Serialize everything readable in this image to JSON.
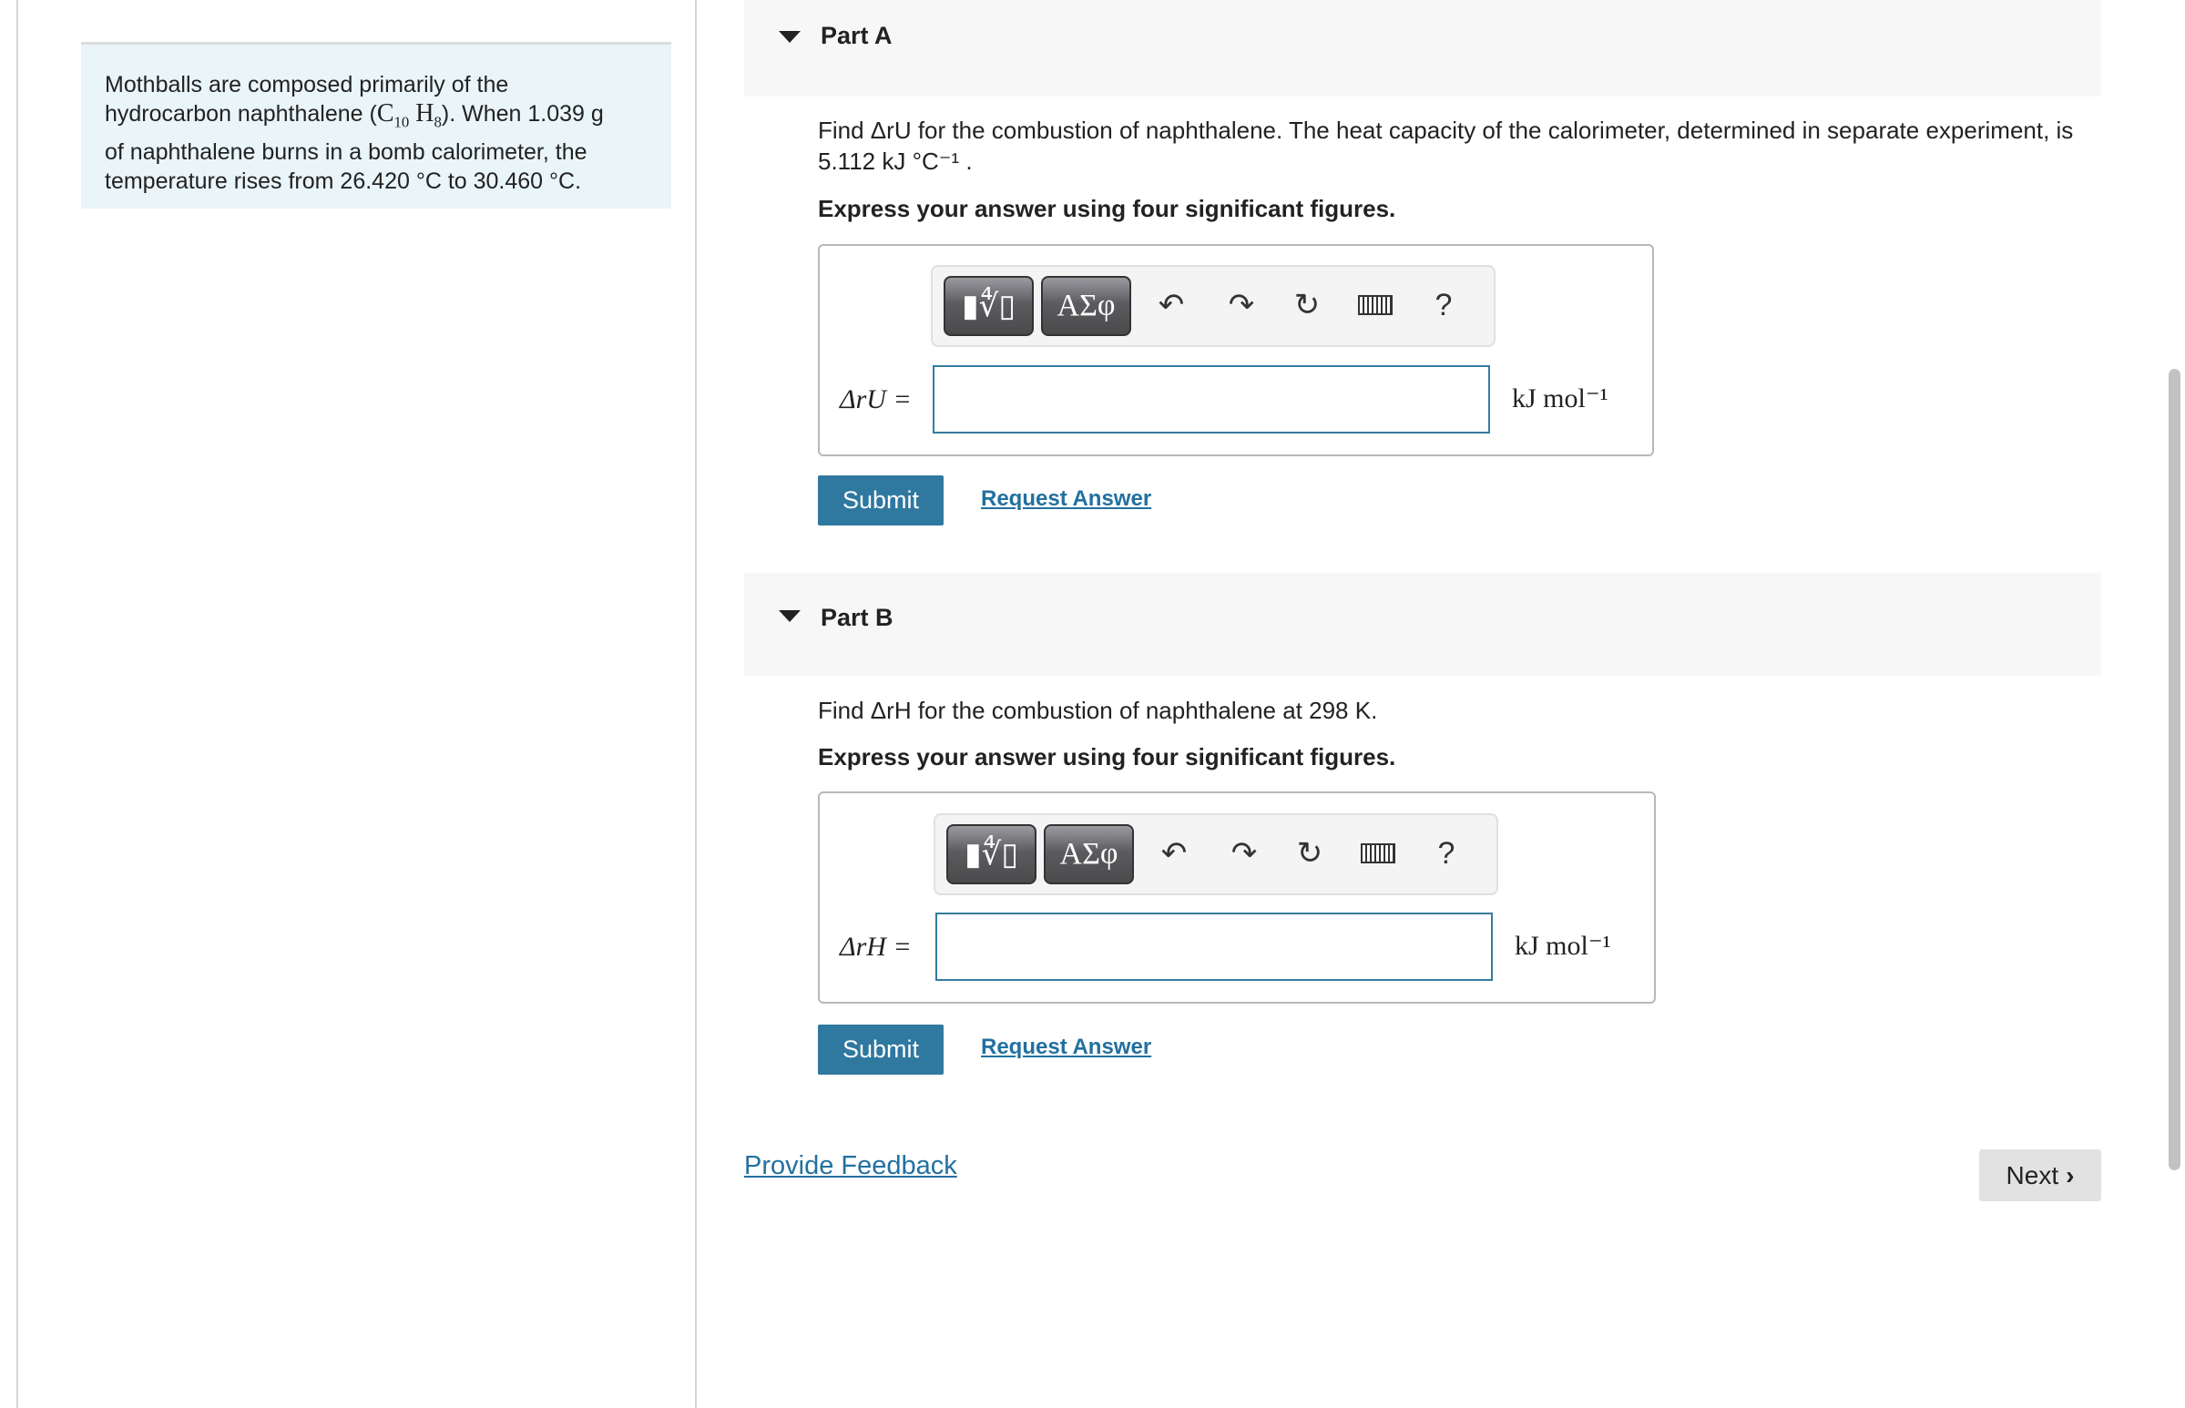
{
  "intro": {
    "line1": "Mothballs are composed primarily of the",
    "line2_pre": "hydrocarbon naphthalene (",
    "formula": "C10 H8",
    "line2_post": "). When 1.039 g",
    "line3": "of naphthalene burns in a bomb calorimeter, the",
    "line4": "temperature rises from 26.420 °C to 30.460 °C."
  },
  "parts": [
    {
      "title": "Part A",
      "question_line1": "Find ΔrU for the combustion of naphthalene. The heat capacity of the calorimeter, determined in separate experiment, is",
      "question_line2": "5.112 kJ °C⁻¹ .",
      "instruction": "Express your answer using four significant figures.",
      "label": "ΔrU =",
      "input_value": "",
      "unit": "kJ mol⁻¹",
      "submit_label": "Submit",
      "request_label": "Request Answer"
    },
    {
      "title": "Part B",
      "question_line1": "Find ΔrH for the combustion of naphthalene at 298 K.",
      "instruction": "Express your answer using four significant figures.",
      "label": "ΔrH =",
      "input_value": "",
      "unit": "kJ mol⁻¹",
      "submit_label": "Submit",
      "request_label": "Request Answer"
    }
  ],
  "toolbar": {
    "templates_label": "▮∜▯",
    "greek_label": "ΑΣφ",
    "icons": [
      "templates-icon",
      "greek-symbols-icon",
      "undo-icon",
      "redo-icon",
      "reset-icon",
      "keyboard-icon",
      "help-icon"
    ],
    "help_label": "?"
  },
  "footer": {
    "feedback_label": "Provide Feedback",
    "next_label": "Next"
  },
  "colors": {
    "accent": "#2f78a0",
    "intro_bg": "#e9f5f8",
    "header_bg": "#f7f7f7"
  }
}
